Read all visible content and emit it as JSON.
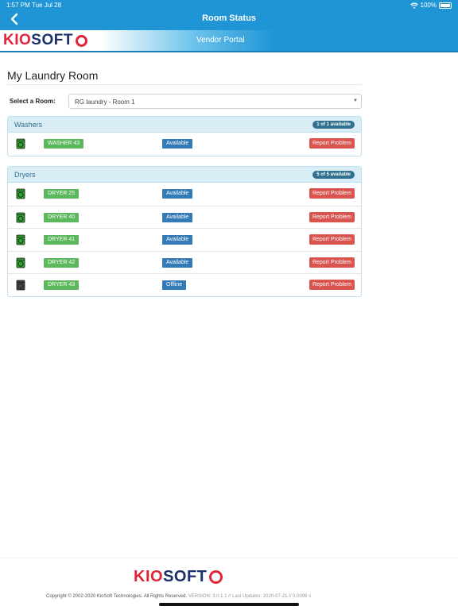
{
  "status_bar": {
    "time": "1:57 PM",
    "date": "Tue Jul 28",
    "battery": "100%"
  },
  "nav": {
    "title": "Room Status",
    "back_icon": "chevron-left-icon"
  },
  "brand": {
    "logo_text_left": "KIO",
    "logo_text_right": "SOFT",
    "subtitle": "Vendor Portal"
  },
  "page": {
    "title": "My Laundry Room",
    "select_label": "Select a Room:",
    "selected_room": "RG laundry - Room 1"
  },
  "washers": {
    "title": "Washers",
    "badge": "1 of 1 available",
    "rows": [
      {
        "name": "WASHER 43",
        "status": "Available",
        "action": "Report Problem",
        "icon": "washer-icon",
        "icon_color": "#2ea82e"
      }
    ]
  },
  "dryers": {
    "title": "Dryers",
    "badge": "5 of 5 available",
    "rows": [
      {
        "name": "DRYER 25",
        "status": "Available",
        "action": "Report Problem",
        "icon": "dryer-icon",
        "icon_color": "#2ea82e"
      },
      {
        "name": "DRYER 40",
        "status": "Available",
        "action": "Report Problem",
        "icon": "dryer-icon",
        "icon_color": "#2ea82e"
      },
      {
        "name": "DRYER 41",
        "status": "Available",
        "action": "Report Problem",
        "icon": "dryer-icon",
        "icon_color": "#2ea82e"
      },
      {
        "name": "DRYER 42",
        "status": "Available",
        "action": "Report Problem",
        "icon": "dryer-icon",
        "icon_color": "#2ea82e"
      },
      {
        "name": "DRYER 43",
        "status": "Offline",
        "action": "Report Problem",
        "icon": "dryer-icon",
        "icon_color": "#444444"
      }
    ]
  },
  "footer": {
    "copyright": "Copyright © 2002-2020 KioSoft Technologies. All Rights Reserved.",
    "version": "VERSION: 3.0.1.1 // Last Updates: 2020-07-21 // 0.0099 s"
  },
  "colors": {
    "nav_bg": "#1f95d5",
    "panel_head_bg": "#d9edf7",
    "tag_green": "#5cb85c",
    "status_blue": "#337ab7",
    "report_red": "#d9534f",
    "logo_red": "#e0243a",
    "logo_navy": "#1c2f6b"
  }
}
